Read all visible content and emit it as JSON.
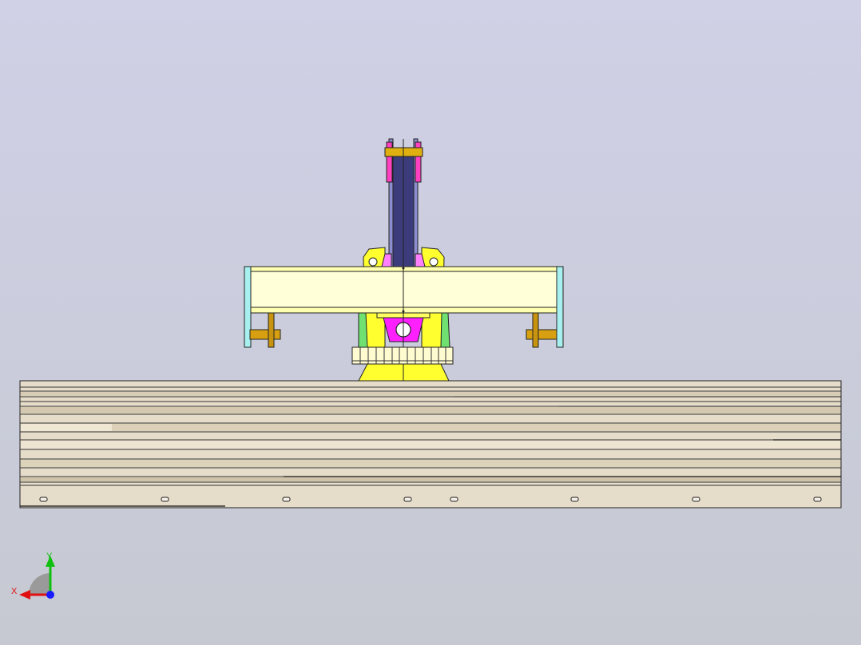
{
  "view": {
    "background_top": "#d0d0e6",
    "background_bottom": "#c6c9d1"
  },
  "triad": {
    "x_label": "X",
    "y_label": "Y",
    "x_color": "#e01010",
    "y_color": "#10c010",
    "z_color": "#1a1aff"
  },
  "model": {
    "base_rail_color": "#e8dcc8",
    "column_color": "#ffff2a",
    "crossbeam_color": "#ffffd8",
    "mast_color": "#3c3c7c",
    "joint_color": "#ff30ff",
    "bracket_color": "#a8f0f0",
    "pin_color": "#d8a010"
  }
}
